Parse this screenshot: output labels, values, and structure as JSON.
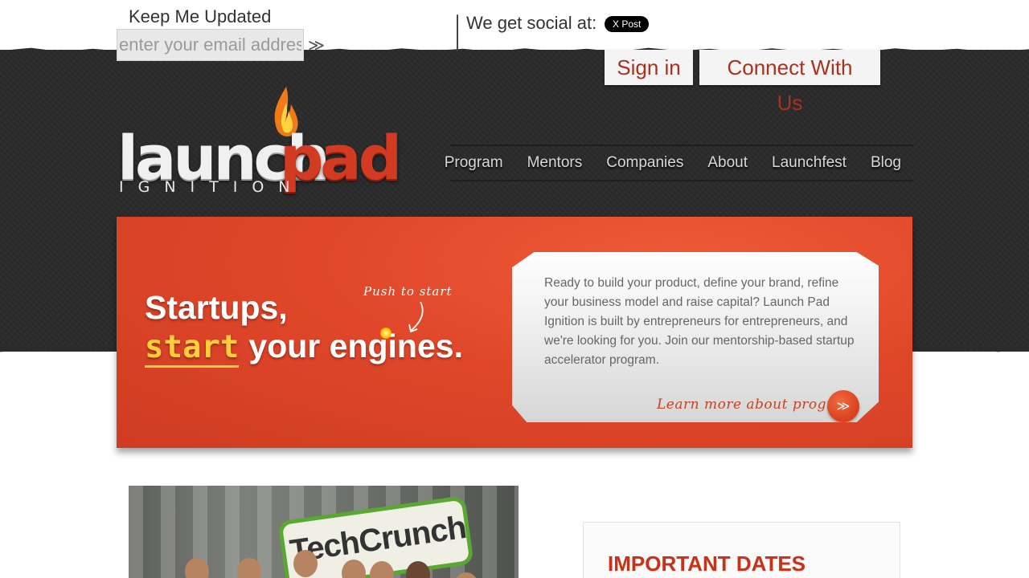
{
  "newsletter": {
    "label": "Keep Me Updated",
    "email_placeholder": "enter your email address",
    "submit_glyph": "≫"
  },
  "social": {
    "label": "We get social at:",
    "x_post_label": "X Post"
  },
  "top_tabs": {
    "sign_in": "Sign in",
    "connect": "Connect With Us"
  },
  "logo": {
    "launch": "launch",
    "pad": "pad",
    "tagline": "IGNITION"
  },
  "nav": {
    "items": [
      "Program",
      "Mentors",
      "Companies",
      "About",
      "Launchfest",
      "Blog"
    ]
  },
  "hero": {
    "line1": "Startups,",
    "start_word": "start",
    "line2_rest": "your engines.",
    "push_note": "Push to start",
    "description": "Ready to build your product, define your brand, refine your business model and raise capital? Launch Pad Ignition is built by entrepreneurs for entrepreneurs, and we're looking for you. Join our mentorship-based startup accelerator program.",
    "learn_more": "Learn more about program",
    "learn_more_glyph": "≫"
  },
  "photo": {
    "sign_text": "TechCrunch"
  },
  "dates": {
    "title": "IMPORTANT DATES"
  },
  "colors": {
    "accent_red": "#d23a22",
    "hero_orange": "#e0472a",
    "highlight_yellow": "#ffcf3a",
    "dark_band": "#2b2b2b"
  }
}
